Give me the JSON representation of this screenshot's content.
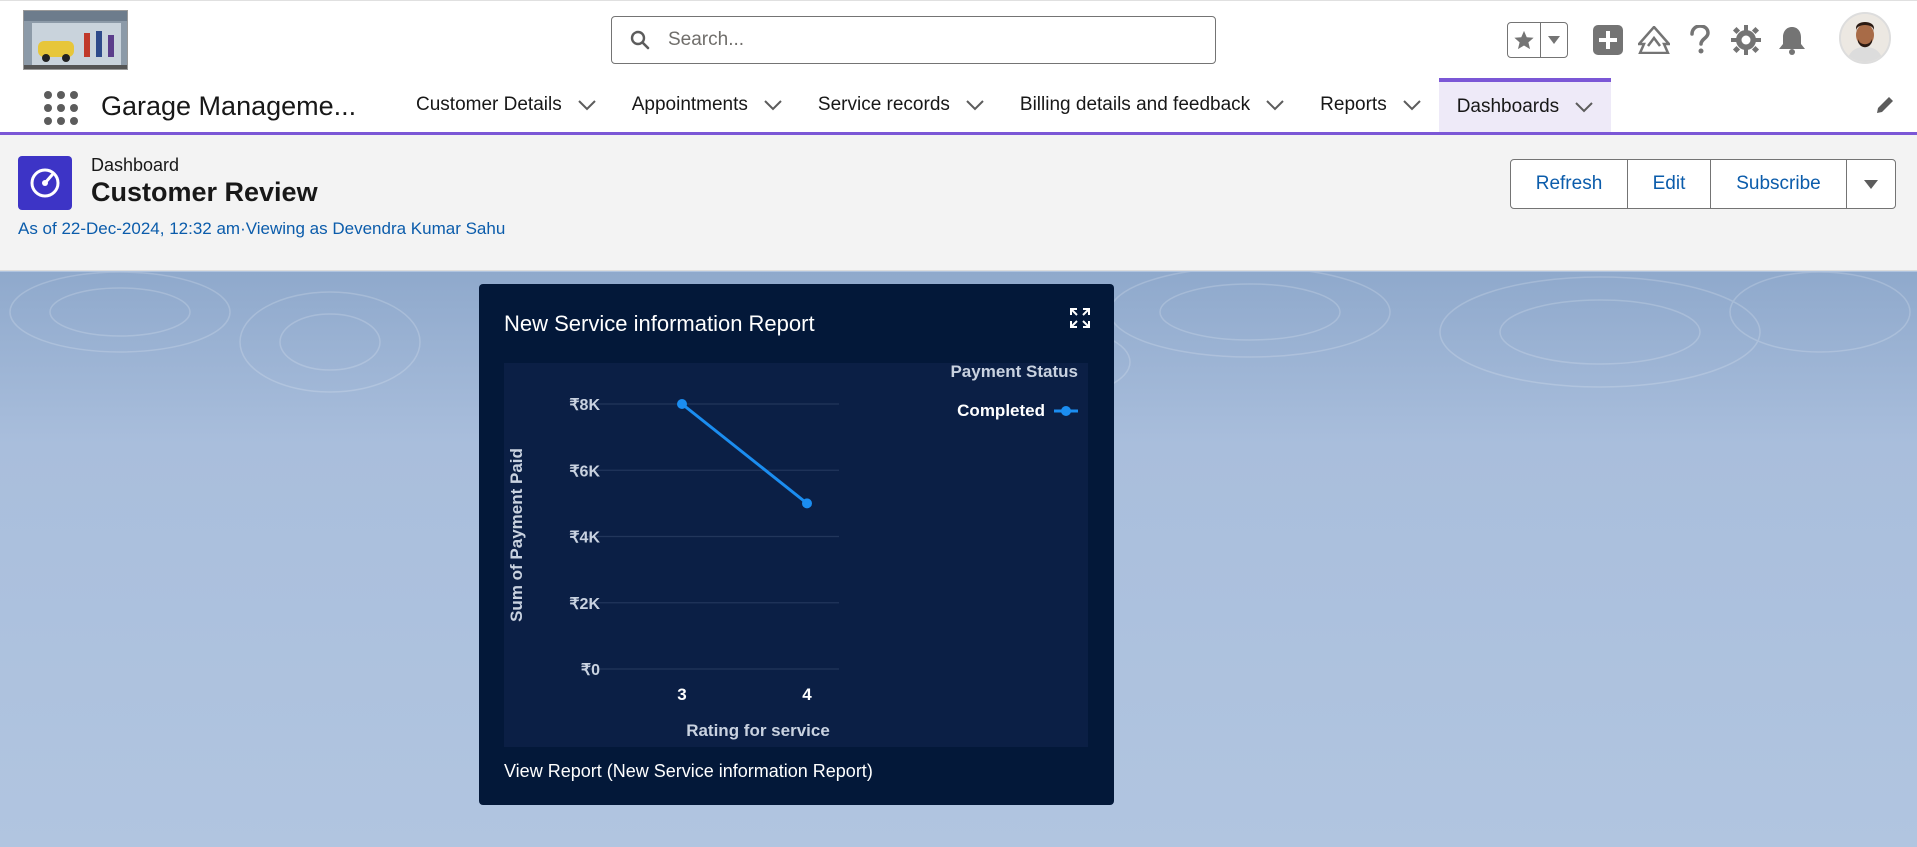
{
  "header": {
    "logo_icon": "garage-logo",
    "search_placeholder": "Search...",
    "icons": [
      "star-icon",
      "chevron-down-icon",
      "add-icon",
      "trailhead-icon",
      "help-icon",
      "gear-icon",
      "bell-icon"
    ]
  },
  "nav": {
    "app_name": "Garage Manageme...",
    "tabs": [
      {
        "label": "Customer Details",
        "active": false
      },
      {
        "label": "Appointments",
        "active": false
      },
      {
        "label": "Service records",
        "active": false
      },
      {
        "label": "Billing details and feedback",
        "active": false
      },
      {
        "label": "Reports",
        "active": false
      },
      {
        "label": "Dashboards",
        "active": true
      }
    ]
  },
  "dashboard": {
    "type_label": "Dashboard",
    "title": "Customer Review",
    "meta": "As of 22-Dec-2024, 12:32 am·Viewing as Devendra Kumar Sahu",
    "buttons": {
      "refresh": "Refresh",
      "edit": "Edit",
      "subscribe": "Subscribe"
    }
  },
  "widget": {
    "title": "New Service information Report",
    "view_report": "View Report (New Service information Report)",
    "legend_title": "Payment Status",
    "legend_item": "Completed"
  },
  "colors": {
    "accent": "#7b57d6",
    "link": "#0b5cab",
    "widget_bg": "#031839",
    "series": "#1b8df0"
  },
  "chart_data": {
    "type": "line",
    "title": "New Service information Report",
    "xlabel": "Rating for service",
    "ylabel": "Sum of Payment Paid",
    "x": [
      "3",
      "4"
    ],
    "ylim": [
      0,
      8000
    ],
    "yticks": [
      0,
      2000,
      4000,
      6000,
      8000
    ],
    "ytick_labels": [
      "₹0",
      "₹2K",
      "₹4K",
      "₹6K",
      "₹8K"
    ],
    "series": [
      {
        "name": "Completed",
        "values": [
          8000,
          5000
        ]
      }
    ],
    "legend_title": "Payment Status",
    "legend_position": "top-right",
    "grid": true
  }
}
